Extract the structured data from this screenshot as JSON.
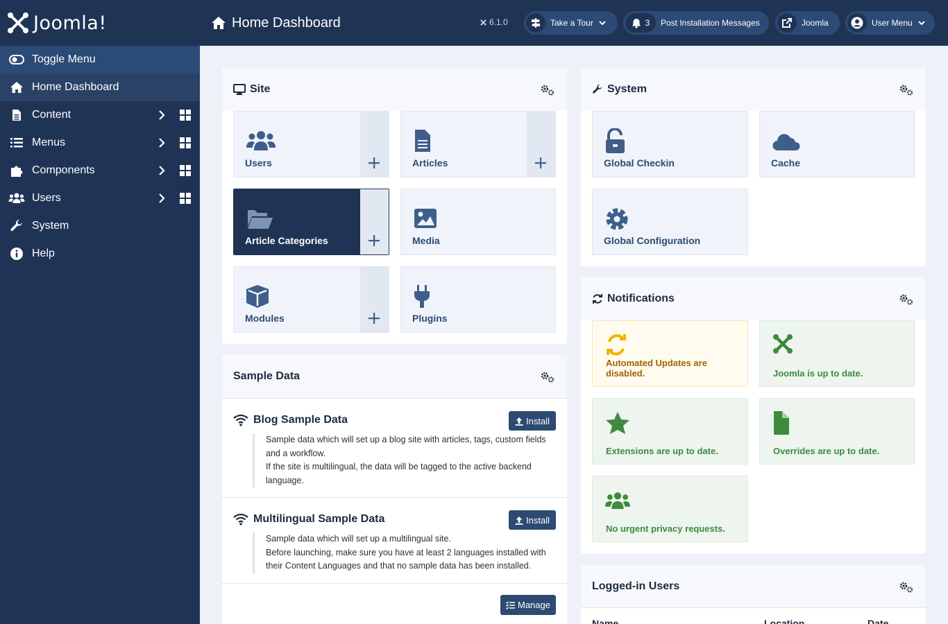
{
  "app": {
    "logo_text": "Joomla!",
    "version": "6.1.0"
  },
  "sidebar": {
    "items": [
      {
        "label": "Toggle Menu",
        "icon": "toggle-icon"
      },
      {
        "label": "Home Dashboard",
        "icon": "home-icon"
      },
      {
        "label": "Content",
        "icon": "file-icon",
        "submenu": true
      },
      {
        "label": "Menus",
        "icon": "list-icon",
        "submenu": true
      },
      {
        "label": "Components",
        "icon": "puzzle-icon",
        "submenu": true
      },
      {
        "label": "Users",
        "icon": "users-icon",
        "submenu": true
      },
      {
        "label": "System",
        "icon": "wrench-icon"
      },
      {
        "label": "Help",
        "icon": "info-icon"
      }
    ]
  },
  "header": {
    "title": "Home Dashboard",
    "tour_label": "Take a Tour",
    "messages_count": "3",
    "messages_label": "Post Installation Messages",
    "joomla_label": "Joomla",
    "user_menu_label": "User Menu"
  },
  "site": {
    "title": "Site",
    "tiles": [
      {
        "label": "Users",
        "icon": "users-icon",
        "add": true
      },
      {
        "label": "Articles",
        "icon": "file-alt-icon",
        "add": true
      },
      {
        "label": "Article Categories",
        "icon": "folder-open-icon",
        "add": true
      },
      {
        "label": "Media",
        "icon": "image-icon",
        "add": false
      },
      {
        "label": "Modules",
        "icon": "cube-icon",
        "add": true
      },
      {
        "label": "Plugins",
        "icon": "plug-icon",
        "add": false
      }
    ]
  },
  "system": {
    "title": "System",
    "tiles": [
      {
        "label": "Global Checkin",
        "icon": "unlock-icon"
      },
      {
        "label": "Cache",
        "icon": "cloud-icon"
      },
      {
        "label": "Global Configuration",
        "icon": "cog-icon"
      }
    ]
  },
  "notifications": {
    "title": "Notifications",
    "items": [
      {
        "label": "Automated Updates are disabled.",
        "icon": "sync-icon",
        "status": "warning"
      },
      {
        "label": "Joomla is up to date.",
        "icon": "joomla-icon",
        "status": "ok"
      },
      {
        "label": "Extensions are up to date.",
        "icon": "star-icon",
        "status": "ok"
      },
      {
        "label": "Overrides are up to date.",
        "icon": "file-icon",
        "status": "ok"
      },
      {
        "label": "No urgent privacy requests.",
        "icon": "users-icon",
        "status": "ok"
      }
    ]
  },
  "sample_data": {
    "title": "Sample Data",
    "blog": {
      "title": "Blog Sample Data",
      "line1": "Sample data which will set up a blog site with articles, tags, custom fields",
      "line2": "and a workflow.",
      "line3": "If the site is multilingual, the data will be tagged to the active backend",
      "line4": "language.",
      "install": "Install"
    },
    "multi": {
      "title": "Multilingual Sample Data",
      "line1": "Sample data which will set up a multilingual site.",
      "line2": "Before launching, make sure you have at least 2 languages installed with",
      "line3": "their Content Languages and that no sample data has been installed.",
      "install": "Install"
    },
    "manage": "Manage"
  },
  "logged_in": {
    "title": "Logged-in Users",
    "columns": [
      "Name",
      "Location",
      "Date"
    ]
  },
  "colors": {
    "primary": "#1f3455",
    "accent": "#2d4a72",
    "success": "#3e8a3e",
    "warning": "#a06400",
    "warning_icon": "#f4b400"
  }
}
